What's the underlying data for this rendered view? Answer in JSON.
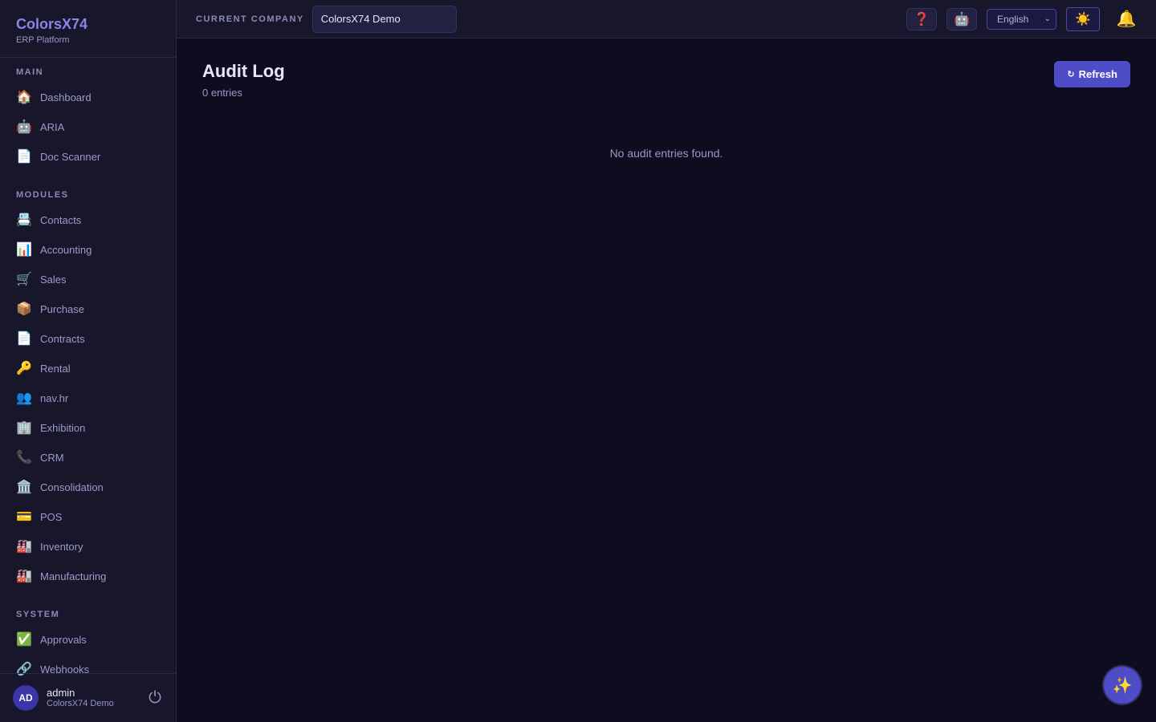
{
  "brand": {
    "title": "ColorsX74",
    "subtitle": "ERP Platform"
  },
  "sidebar": {
    "sections": [
      {
        "label": "MAIN",
        "items": [
          {
            "icon": "🏠",
            "icon_name": "home-icon",
            "label": "Dashboard"
          },
          {
            "icon": "🤖",
            "icon_name": "robot-icon",
            "label": "ARIA"
          },
          {
            "icon": "📄",
            "icon_name": "document-icon",
            "label": "Doc Scanner"
          }
        ]
      },
      {
        "label": "MODULES",
        "items": [
          {
            "icon": "📇",
            "icon_name": "card-index-icon",
            "label": "Contacts"
          },
          {
            "icon": "📊",
            "icon_name": "bar-chart-icon",
            "label": "Accounting"
          },
          {
            "icon": "🛒",
            "icon_name": "shopping-cart-icon",
            "label": "Sales"
          },
          {
            "icon": "📦",
            "icon_name": "package-icon",
            "label": "Purchase"
          },
          {
            "icon": "📄",
            "icon_name": "document-icon",
            "label": "Contracts"
          },
          {
            "icon": "🔑",
            "icon_name": "key-icon",
            "label": "Rental"
          },
          {
            "icon": "👥",
            "icon_name": "people-icon",
            "label": "nav.hr"
          },
          {
            "icon": "🏢",
            "icon_name": "office-building-icon",
            "label": "Exhibition"
          },
          {
            "icon": "📞",
            "icon_name": "phone-icon",
            "label": "CRM"
          },
          {
            "icon": "🏛️",
            "icon_name": "classical-building-icon",
            "label": "Consolidation"
          },
          {
            "icon": "💳",
            "icon_name": "credit-card-icon",
            "label": "POS"
          },
          {
            "icon": "🏭",
            "icon_name": "factory-icon",
            "label": "Inventory"
          },
          {
            "icon": "🏭",
            "icon_name": "factory-icon",
            "label": "Manufacturing"
          }
        ]
      },
      {
        "label": "SYSTEM",
        "items": [
          {
            "icon": "✅",
            "icon_name": "check-mark-icon",
            "label": "Approvals"
          },
          {
            "icon": "🔗",
            "icon_name": "link-icon",
            "label": "Webhooks"
          }
        ]
      }
    ]
  },
  "user": {
    "initials": "AD",
    "name": "admin",
    "company": "ColorsX74 Demo",
    "logout_icon": "⏻"
  },
  "topbar": {
    "company_label": "CURRENT COMPANY",
    "company_value": "ColorsX74 Demo",
    "help_icon": "❓",
    "assistant_icon": "🤖",
    "language": "English",
    "theme_icon": "☀️",
    "bell_icon": "🔔"
  },
  "page": {
    "title": "Audit Log",
    "subtitle": "0 entries",
    "refresh_icon": "↻",
    "refresh_label": "Refresh",
    "empty_message": "No audit entries found."
  },
  "fab": {
    "icon": "✨"
  },
  "colors": {
    "accent": "#4f4cc7",
    "brand": "#8a85e8",
    "background": "#0e0d1f",
    "sidebar": "#17162b"
  }
}
